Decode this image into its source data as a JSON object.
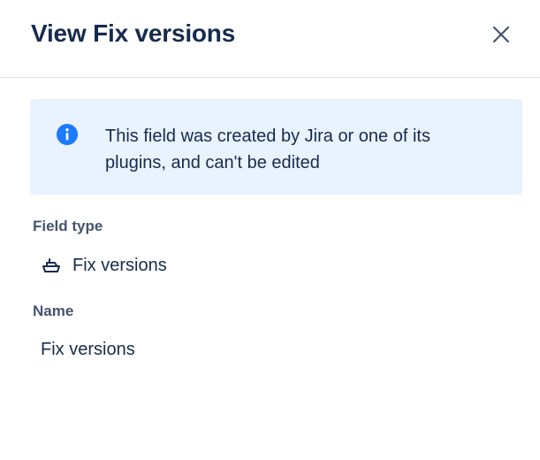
{
  "dialog": {
    "title": "View Fix versions",
    "close_icon": "close-icon"
  },
  "info_banner": {
    "icon": "info-icon",
    "message": "This field was created by Jira or one of its plugins, and can't be edited",
    "accent_color": "#1d7afc",
    "background_color": "#e9f2ff"
  },
  "fields": {
    "field_type": {
      "label": "Field type",
      "icon": "ship-icon",
      "value": "Fix versions"
    },
    "name": {
      "label": "Name",
      "value": "Fix versions"
    }
  }
}
